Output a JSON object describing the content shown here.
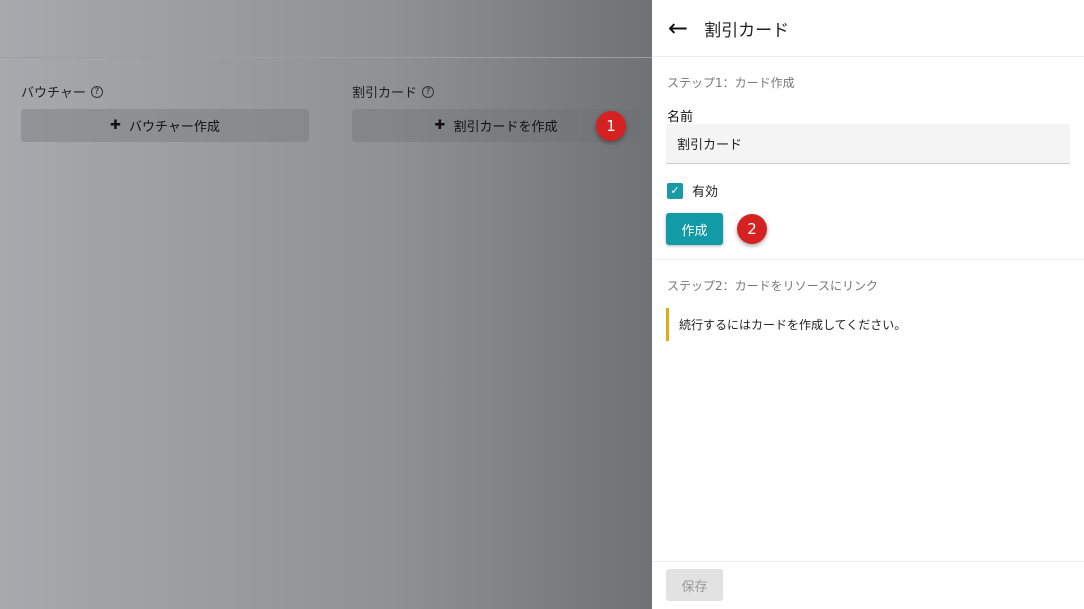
{
  "background": {
    "voucher": {
      "label": "バウチャー",
      "button": "バウチャー作成"
    },
    "discount": {
      "label": "割引カード",
      "button": "割引カードを作成"
    },
    "help_icon": "?",
    "plus_icon": "✚"
  },
  "badges": [
    "1",
    "2"
  ],
  "panel": {
    "title": "割引カード",
    "back_icon": "←",
    "step1": "ステップ1：カード作成",
    "name_label": "名前",
    "name_value": "割引カード",
    "enabled_label": "有効",
    "enabled_checked": true,
    "create_button": "作成",
    "step2": "ステップ2：カードをリソースにリンク",
    "notice": "続行するにはカードを作成してください。",
    "save_button": "保存"
  },
  "colors": {
    "accent": "#129ba6",
    "badge": "#d42222",
    "warning": "#e6a817"
  }
}
